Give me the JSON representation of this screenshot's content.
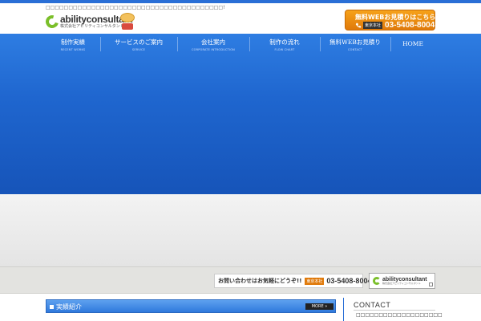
{
  "header": {
    "tagline": "□□□□□□□□□□□□□□□□□□□□□□□□□□□□□□□□□□□□□□□!",
    "logo_en": "abilityconsultant",
    "logo_jp": "株式会社アビリティコンサルタント"
  },
  "phone_box": {
    "line1": "無料WEBお見積りはこちらから",
    "tag": "東京本社",
    "number": "03-5408-8004"
  },
  "nav": {
    "items": [
      {
        "label": "制作実績",
        "sub": "RECENT WORKS"
      },
      {
        "label": "サービスのご案内",
        "sub": "SERVICE"
      },
      {
        "label": "会社案内",
        "sub": "CORPORATE INTRODUCTION"
      },
      {
        "label": "制作の流れ",
        "sub": "FLOW CHART"
      },
      {
        "label": "無料WEBお見積り",
        "sub": "CONTACT"
      },
      {
        "label": "HOME",
        "sub": ""
      }
    ]
  },
  "contact_strip": {
    "text": "お問い合わせはお気軽にどうぞ!!",
    "tag": "東京本社",
    "number": "03-5408-8004",
    "logo_en": "abilityconsultant",
    "logo_jp": "株式会社アビリティコンサルタント"
  },
  "works": {
    "title": "実績紹介",
    "more": "MORE »"
  },
  "sidebar": {
    "heading": "CONTACT",
    "desc": "□□□□□□□□□□□□□□□□□□□"
  },
  "colors": {
    "accent": "#2a6fd6",
    "hero_top": "#2e7de2",
    "orange": "#e07a0b",
    "logo_green": "#7bbf2a"
  }
}
